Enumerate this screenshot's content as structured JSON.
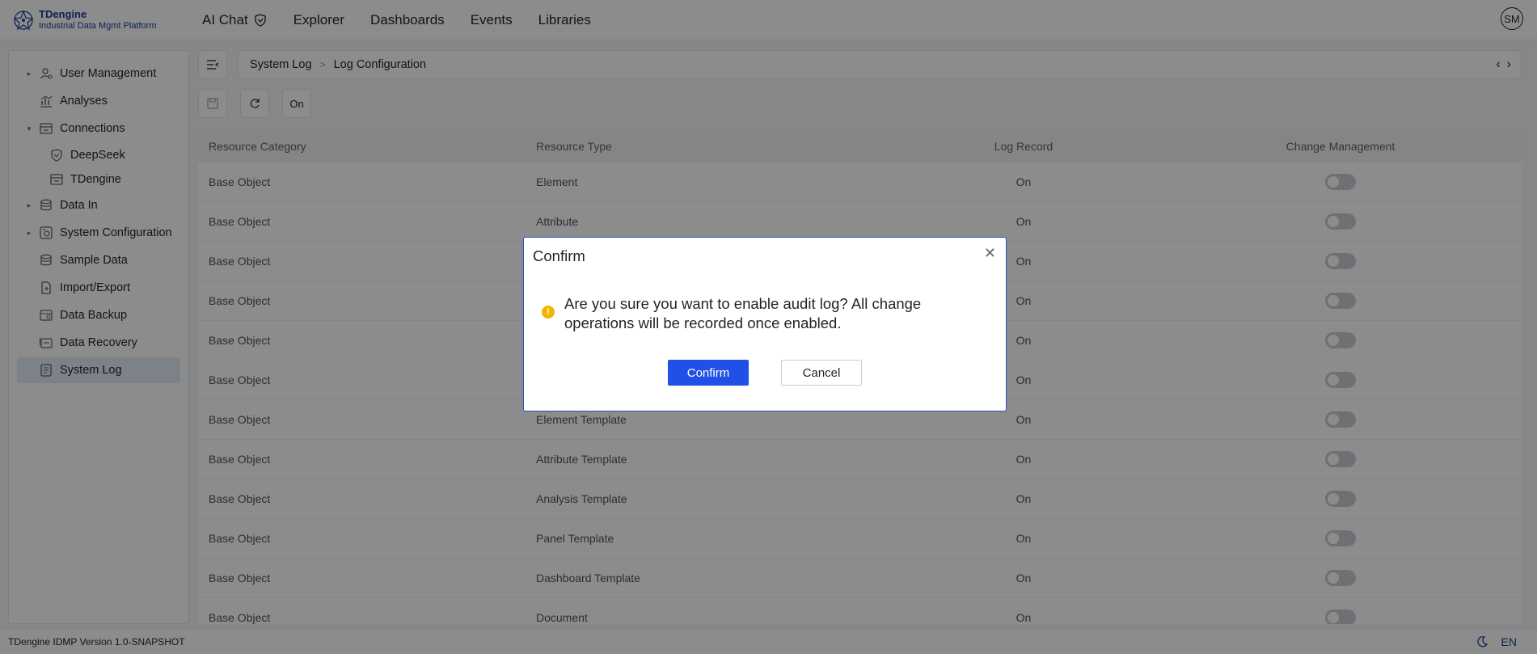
{
  "app": {
    "logo_name": "TDengine",
    "logo_sub": "Industrial Data Mgmt Platform",
    "avatar": "SM"
  },
  "nav": [
    {
      "label": "AI Chat",
      "icon": "shield-icon"
    },
    {
      "label": "Explorer"
    },
    {
      "label": "Dashboards"
    },
    {
      "label": "Events"
    },
    {
      "label": "Libraries"
    }
  ],
  "sidebar": {
    "items": [
      {
        "label": "User Management",
        "icon": "user-icon",
        "caret": "▸"
      },
      {
        "label": "Analyses",
        "icon": "chart-icon",
        "caret": ""
      },
      {
        "label": "Connections",
        "icon": "connection-icon",
        "caret": "▾"
      },
      {
        "label": "DeepSeek",
        "icon": "shield-icon",
        "caret": ""
      },
      {
        "label": "TDengine",
        "icon": "connection-icon",
        "caret": ""
      },
      {
        "label": "Data In",
        "icon": "database-icon",
        "caret": "▸"
      },
      {
        "label": "System Configuration",
        "icon": "settings-icon",
        "caret": "▸"
      },
      {
        "label": "Sample Data",
        "icon": "database-icon",
        "caret": ""
      },
      {
        "label": "Import/Export",
        "icon": "file-icon",
        "caret": ""
      },
      {
        "label": "Data Backup",
        "icon": "backup-icon",
        "caret": ""
      },
      {
        "label": "Data Recovery",
        "icon": "recovery-icon",
        "caret": ""
      },
      {
        "label": "System Log",
        "icon": "log-icon",
        "caret": ""
      }
    ]
  },
  "breadcrumb": {
    "parent": "System Log",
    "current": "Log Configuration"
  },
  "toolbar": {
    "on_label": "On"
  },
  "table": {
    "headers": [
      "Resource Category",
      "Resource Type",
      "Log Record",
      "Change Management"
    ],
    "rows": [
      {
        "category": "Base Object",
        "type": "Element",
        "log": "On"
      },
      {
        "category": "Base Object",
        "type": "Attribute",
        "log": "On"
      },
      {
        "category": "Base Object",
        "type": "",
        "log": "On"
      },
      {
        "category": "Base Object",
        "type": "",
        "log": "On"
      },
      {
        "category": "Base Object",
        "type": "",
        "log": "On"
      },
      {
        "category": "Base Object",
        "type": "",
        "log": "On"
      },
      {
        "category": "Base Object",
        "type": "Element Template",
        "log": "On"
      },
      {
        "category": "Base Object",
        "type": "Attribute Template",
        "log": "On"
      },
      {
        "category": "Base Object",
        "type": "Analysis Template",
        "log": "On"
      },
      {
        "category": "Base Object",
        "type": "Panel Template",
        "log": "On"
      },
      {
        "category": "Base Object",
        "type": "Dashboard Template",
        "log": "On"
      },
      {
        "category": "Base Object",
        "type": "Document",
        "log": "On"
      }
    ]
  },
  "footer": {
    "version": "TDengine IDMP Version 1.0-SNAPSHOT",
    "lang": "EN"
  },
  "modal": {
    "title": "Confirm",
    "message": "Are you sure you want to enable audit log? All change operations will be recorded once enabled.",
    "confirm_label": "Confirm",
    "cancel_label": "Cancel"
  },
  "colors": {
    "accent": "#2050e6",
    "brand": "#1f3e9c",
    "warning": "#f5b400"
  }
}
